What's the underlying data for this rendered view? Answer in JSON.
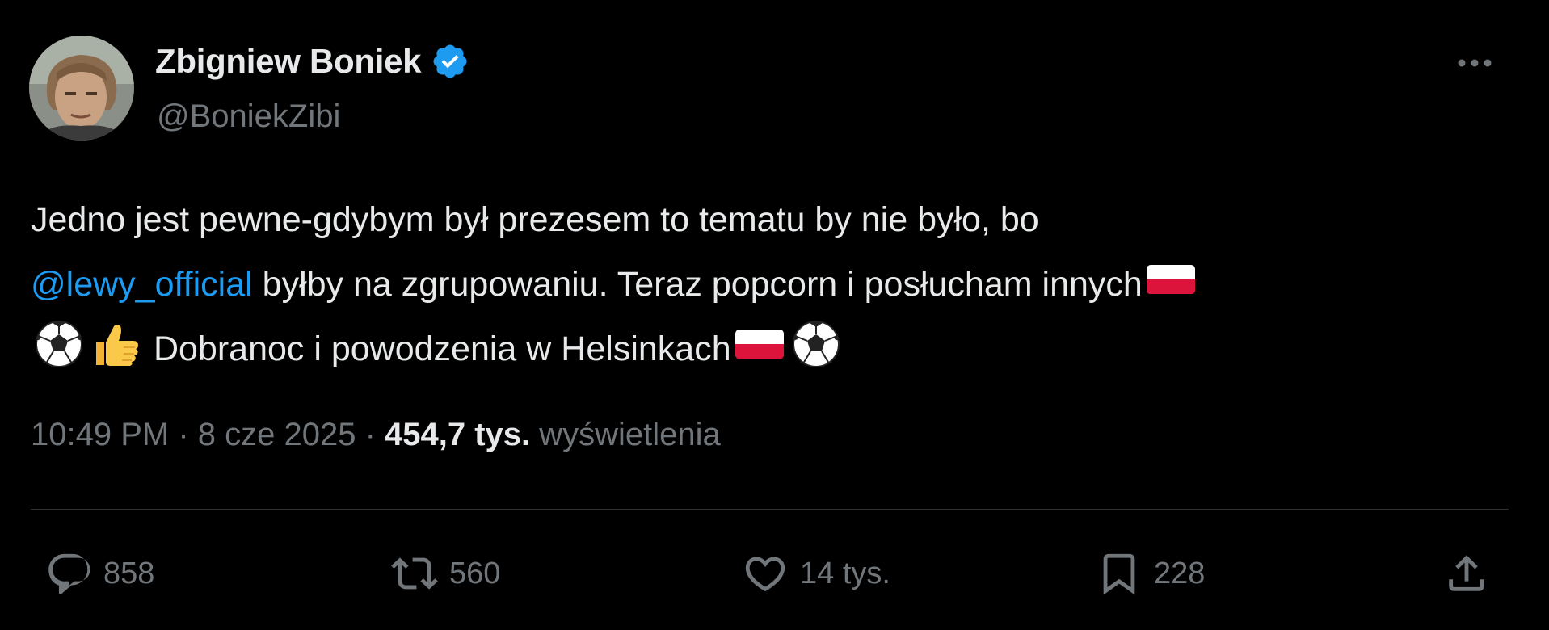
{
  "author": {
    "display_name": "Zbigniew Boniek",
    "handle": "@BoniekZibi",
    "verified": true,
    "avatar_icon": "user-avatar-photo"
  },
  "tweet": {
    "line1": "Jedno jest pewne-gdybym był prezesem to tematu by nie było, bo",
    "mention": "@lewy_official",
    "line2_rest": " byłby na zgrupowaniu. Teraz popcorn i posłucham innych",
    "line3_text": " Dobranoc i powodzenia w Helsinkach",
    "emojis": [
      "poland-flag",
      "soccer-ball",
      "thumbs-up",
      "poland-flag",
      "soccer-ball"
    ]
  },
  "meta": {
    "time": "10:49 PM",
    "separator1": " · ",
    "date": "8 cze 2025",
    "separator2": " · ",
    "views_count": "454,7 tys.",
    "views_label": " wyświetlenia"
  },
  "actions": {
    "reply_count": "858",
    "repost_count": "560",
    "like_count": "14 tys.",
    "bookmark_count": "228"
  },
  "colors": {
    "background": "#000000",
    "text": "#e7e9ea",
    "secondary": "#71767b",
    "accent": "#1d9bf0",
    "divider": "#2f3336"
  }
}
